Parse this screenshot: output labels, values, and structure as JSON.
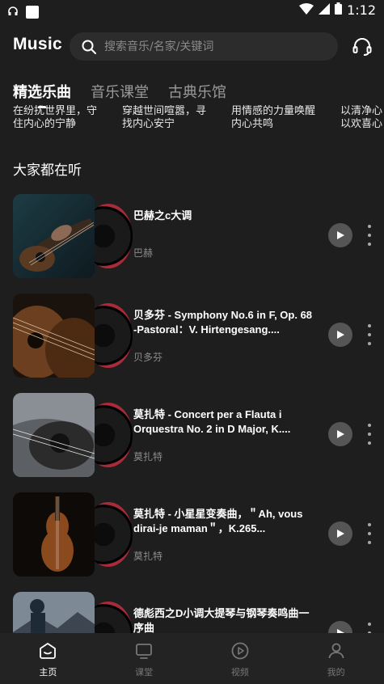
{
  "status_bar": {
    "time": "1:12"
  },
  "header": {
    "brand": "Music",
    "search_placeholder": "搜索音乐/名家/关键词"
  },
  "tabs": [
    {
      "label": "精选乐曲",
      "active": true
    },
    {
      "label": "音乐课堂",
      "active": false
    },
    {
      "label": "古典乐馆",
      "active": false
    }
  ],
  "slogans": [
    {
      "line1": "在纷扰世界里，守",
      "line2": "住内心的宁静"
    },
    {
      "line1": "穿越世间喧嚣，寻",
      "line2": "找内心安宁"
    },
    {
      "line1": "用情感的力量唤醒",
      "line2": "内心共鸣"
    },
    {
      "line1": "以清净心",
      "line2": "以欢喜心"
    }
  ],
  "section": {
    "title": "大家都在听"
  },
  "songs": [
    {
      "title": "巴赫之c大调",
      "artist": "巴赫"
    },
    {
      "title": "贝多芬 - Symphony No.6 in F, Op. 68 -Pastoral：V. Hirtengesang....",
      "artist": "贝多芬"
    },
    {
      "title": "莫扎特 - Concert per a Flauta i Orquestra No. 2 in D Major, K....",
      "artist": "莫扎特"
    },
    {
      "title": "莫扎特 - 小星星变奏曲，＂Ah, vous dirai-je maman＂，K.265...",
      "artist": "莫扎特"
    },
    {
      "title": "德彪西之D小调大提琴与钢琴奏鸣曲一序曲",
      "artist": ""
    }
  ],
  "bottom_nav": [
    {
      "label": "主页",
      "icon": "home-icon",
      "active": true
    },
    {
      "label": "课堂",
      "icon": "tv-icon",
      "active": false
    },
    {
      "label": "视频",
      "icon": "video-play-icon",
      "active": false
    },
    {
      "label": "我的",
      "icon": "profile-icon",
      "active": false
    }
  ],
  "colors": {
    "background": "#1e1e1e",
    "vinyl_rim": "#a92b3a"
  }
}
